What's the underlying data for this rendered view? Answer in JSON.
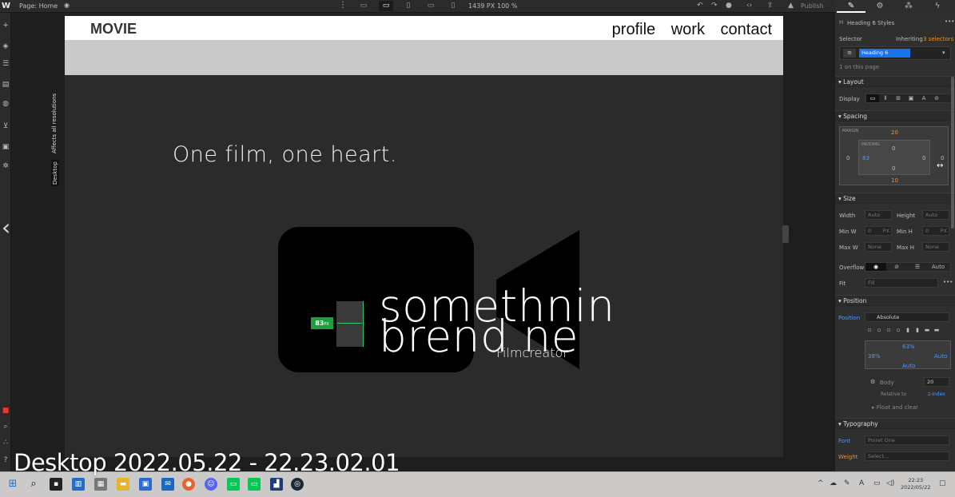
{
  "topbar": {
    "logo": "W",
    "page_label": "Page: Home",
    "canvas_width": "1439 PX",
    "zoom": "100 %",
    "publish": "Publish"
  },
  "canvas": {
    "brand": "MOVIE",
    "nav": [
      "profile",
      "work",
      "contact"
    ],
    "tagline": "One film, one heart.",
    "heading": "somethnin brend ne",
    "subheading": "Filmcreator",
    "padding_badge": "83",
    "padding_badge_unit": "PX"
  },
  "side_labels": {
    "affects": "Affects all resolutions",
    "desktop": "Desktop"
  },
  "panel": {
    "title": "Heading 6 Styles",
    "selector_label": "Selector",
    "inheriting_prefix": "Inheriting",
    "inheriting_count": "3 selectors",
    "selector_tag": "Heading 6",
    "on_page": "1 on this page",
    "layout": "Layout",
    "display": "Display",
    "spacing": "Spacing",
    "margin_label": "MARGIN",
    "padding_label": "PADDING",
    "margin_top": "20",
    "margin_bottom": "10",
    "margin_left": "0",
    "margin_right": "0",
    "padding_top": "0",
    "padding_bottom": "0",
    "padding_left": "83",
    "padding_right": "0",
    "size": "Size",
    "width_label": "Width",
    "width_val": "Auto",
    "height_label": "Height",
    "height_val": "Auto",
    "minw_label": "Min W",
    "minw_val": "0",
    "minw_unit": "PX",
    "minh_label": "Min H",
    "minh_val": "0",
    "minh_unit": "PX",
    "maxw_label": "Max W",
    "maxw_val": "None",
    "maxh_label": "Max H",
    "maxh_val": "None",
    "overflow_label": "Overflow",
    "overflow_auto": "Auto",
    "fit_label": "Fit",
    "fit_val": "Fill",
    "position": "Position",
    "position_label": "Position",
    "position_val": "Absolute",
    "pos_top": "63%",
    "pos_left": "38%",
    "pos_right": "Auto",
    "pos_bottom": "Auto",
    "relative_body": "Body",
    "z_val": "20",
    "relative_to": "Relative to",
    "z_index": "z-index",
    "float_clear": "Float and clear",
    "typography": "Typography",
    "font_label": "Font",
    "font_val": "Poiret One",
    "weight_label": "Weight",
    "weight_val": "Select..."
  },
  "taskbar": {
    "time": "22:23",
    "date": "2022/05/22",
    "lang": "A"
  },
  "watermark": "Desktop 2022.05.22 - 22.23.02.01",
  "colors": {
    "accent_blue": "#1a73e8",
    "badge_green": "#1f9e3f",
    "orange": "#e8912d"
  }
}
